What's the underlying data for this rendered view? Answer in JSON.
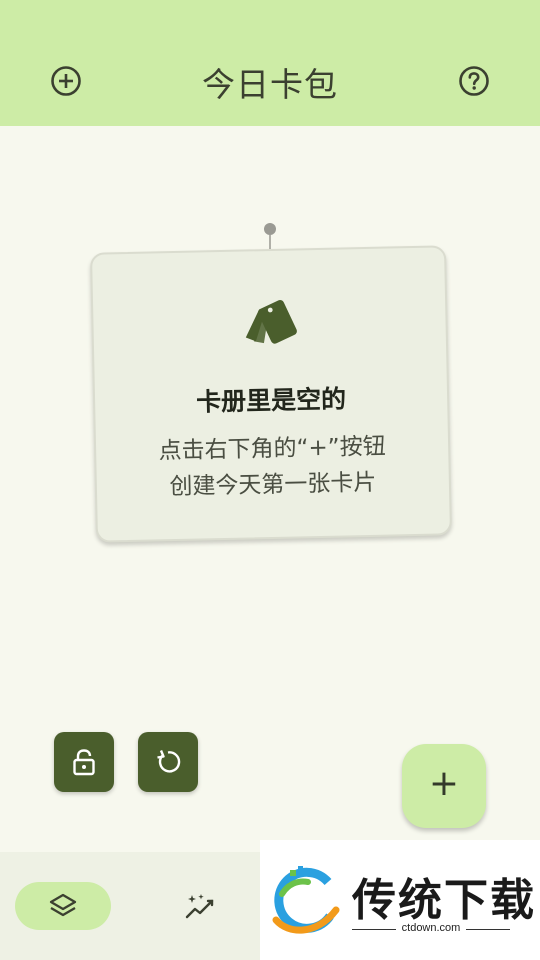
{
  "header": {
    "title": "今日卡包",
    "add_icon": "plus-circle-icon",
    "help_icon": "question-circle-icon"
  },
  "empty_card": {
    "icon": "cards-icon",
    "title": "卡册里是空的",
    "line1": "点击右下角的“+”按钮",
    "line2": "创建今天第一张卡片"
  },
  "actions": {
    "lock_icon": "unlock-icon",
    "reset_icon": "refresh-icon",
    "fab_label": "+"
  },
  "bottom_nav": {
    "items": [
      {
        "icon": "layers-icon",
        "active": true
      },
      {
        "icon": "sparkle-trend-icon",
        "active": false
      }
    ]
  },
  "watermark": {
    "title": "传统下载",
    "subtitle": "ctdown.com"
  },
  "colors": {
    "accent_light": "#cdeca6",
    "accent_dark": "#4a5e2c",
    "background": "#f7f8ee",
    "card": "#ecefe2"
  }
}
